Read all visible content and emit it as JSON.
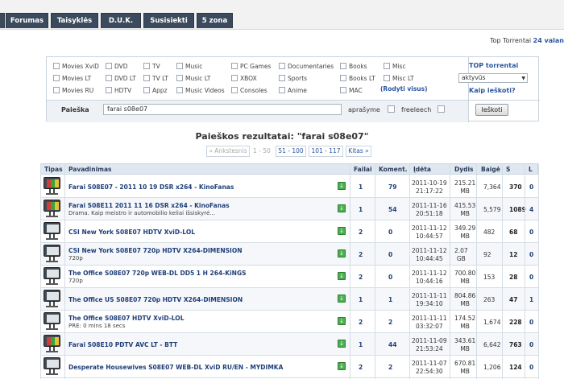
{
  "nav": {
    "tabs": [
      "Forumas",
      "Taisyklės",
      "D.U.K.",
      "Susisiekti",
      "5 zona"
    ],
    "top_right_prefix": "Top Torrentai",
    "top_right_value": "24 valan"
  },
  "search": {
    "categories": [
      [
        "Movies XviD",
        "DVD",
        "TV",
        "Music",
        "PC Games",
        "Documentaries",
        "Books",
        "Misc"
      ],
      [
        "Movies LT",
        "DVD LT",
        "TV LT",
        "Music LT",
        "XBOX",
        "Sports",
        "Books LT",
        "Misc LT"
      ],
      [
        "Movies RU",
        "HDTV",
        "Appz",
        "Music Videos",
        "Consoles",
        "Anime",
        "MAC"
      ]
    ],
    "show_all": "(Rodyti visus)",
    "top_label": "TOP torrentai",
    "top_select": "aktyvūs",
    "how_to": "Kaip ieškoti?",
    "label": "Paieška",
    "query": "farai s08e07",
    "opt_description": "aprašyme",
    "opt_freeleech": "freeleech",
    "button": "Ieškoti"
  },
  "results": {
    "title": "Paieškos rezultatai: \"farai s08e07\"",
    "pager": {
      "prev": "« Ankstesnis",
      "current": "1 - 50",
      "p2": "51 - 100",
      "p3": "101 - 117",
      "next": "Kitas »"
    },
    "columns": [
      "Tipas",
      "Pavadinimas",
      "Failai",
      "Koment.",
      "Įdėta",
      "Dydis",
      "Baigė",
      "S",
      "L"
    ],
    "rows": [
      {
        "icon": "tv-color-icon",
        "title": "Farai S08E07 - 2011 10 19 DSR x264 - KinoFanas",
        "sub": "",
        "files": "1",
        "comments": "79",
        "date": "2011-10-19",
        "time": "21:17:22",
        "size": "215.21",
        "unit": "MB",
        "done": "7,364",
        "seeders": "370",
        "leechers": "0"
      },
      {
        "icon": "tv-color-icon",
        "title": "Farai S08E11 2011 11 16 DSR x264 - KinoFanas",
        "sub": "Drama. Kaip meistro ir automobilio keliai išsiskyrė...",
        "files": "1",
        "comments": "54",
        "date": "2011-11-16",
        "time": "20:51:18",
        "size": "415.53",
        "unit": "MB",
        "done": "5,579",
        "seeders": "1089",
        "leechers": "4"
      },
      {
        "icon": "tv-icon",
        "title": "CSI New York S08E07 HDTV XviD-LOL",
        "sub": "",
        "files": "2",
        "comments": "0",
        "date": "2011-11-12",
        "time": "10:44:57",
        "size": "349.29",
        "unit": "MB",
        "done": "482",
        "seeders": "68",
        "leechers": "0"
      },
      {
        "icon": "tv-icon",
        "title": "CSI New York S08E07 720p HDTV X264-DIMENSION",
        "sub": "720p",
        "files": "2",
        "comments": "0",
        "date": "2011-11-12",
        "time": "10:44:45",
        "size": "2.07",
        "unit": "GB",
        "done": "92",
        "seeders": "12",
        "leechers": "0"
      },
      {
        "icon": "tv-icon",
        "title": "The Office S08E07 720p WEB-DL DD5 1 H 264-KiNGS",
        "sub": "720p",
        "files": "2",
        "comments": "0",
        "date": "2011-11-12",
        "time": "10:44:16",
        "size": "700.80",
        "unit": "MB",
        "done": "153",
        "seeders": "28",
        "leechers": "0"
      },
      {
        "icon": "tv-icon",
        "title": "The Office US S08E07 720p HDTV X264-DIMENSION",
        "sub": "",
        "files": "1",
        "comments": "1",
        "date": "2011-11-11",
        "time": "19:34:10",
        "size": "804.86",
        "unit": "MB",
        "done": "263",
        "seeders": "47",
        "leechers": "1"
      },
      {
        "icon": "tv-icon",
        "title": "The Office S08E07 HDTV XviD-LOL",
        "sub": "PRE: 0 mins 18 secs",
        "files": "2",
        "comments": "2",
        "date": "2011-11-11",
        "time": "03:32:07",
        "size": "174.52",
        "unit": "MB",
        "done": "1,674",
        "seeders": "228",
        "leechers": "0"
      },
      {
        "icon": "tv-color-icon",
        "title": "Farai S08E10 PDTV AVC LT - BTT",
        "sub": "",
        "files": "1",
        "comments": "44",
        "date": "2011-11-09",
        "time": "21:53:24",
        "size": "343.61",
        "unit": "MB",
        "done": "6,642",
        "seeders": "763",
        "leechers": "0"
      },
      {
        "icon": "tv-icon",
        "title": "Desperate Housewives S08E07 WEB-DL XviD RU/EN - MYDIMKA",
        "sub": "",
        "files": "2",
        "comments": "2",
        "date": "2011-11-07",
        "time": "22:54:30",
        "size": "670.81",
        "unit": "MB",
        "done": "1,206",
        "seeders": "124",
        "leechers": "0"
      }
    ]
  }
}
